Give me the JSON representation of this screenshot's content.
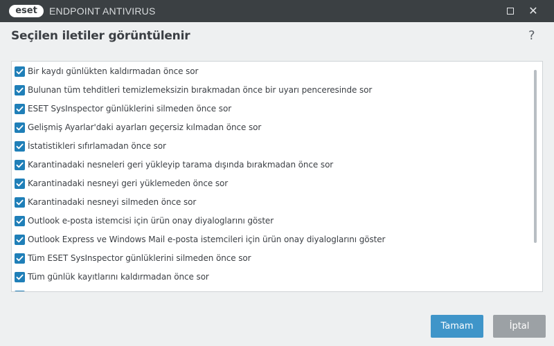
{
  "window": {
    "logo_text": "eset",
    "app_title": "ENDPOINT ANTIVIRUS",
    "maximize_icon": "maximize-icon",
    "close_glyph": "✕"
  },
  "header": {
    "title": "Seçilen iletiler görüntülenir",
    "help_glyph": "?"
  },
  "messages": [
    {
      "label": "Bir kaydı günlükten kaldırmadan önce sor",
      "checked": true
    },
    {
      "label": "Bulunan tüm tehditleri temizlemeksizin bırakmadan önce bir uyarı penceresinde sor",
      "checked": true
    },
    {
      "label": "ESET SysInspector günlüklerini silmeden önce sor",
      "checked": true
    },
    {
      "label": "Gelişmiş Ayarlar'daki ayarları geçersiz kılmadan önce sor",
      "checked": true
    },
    {
      "label": "İstatistikleri sıfırlamadan önce sor",
      "checked": true
    },
    {
      "label": "Karantinadaki nesneleri geri yükleyip tarama dışında bırakmadan önce sor",
      "checked": true
    },
    {
      "label": "Karantinadaki nesneyi geri yüklemeden önce sor",
      "checked": true
    },
    {
      "label": "Karantinadaki nesneyi silmeden önce sor",
      "checked": true
    },
    {
      "label": "Outlook e-posta istemcisi için ürün onay diyaloglarını göster",
      "checked": true
    },
    {
      "label": "Outlook Express ve Windows Mail e-posta istemcileri için ürün onay diyaloglarını göster",
      "checked": true
    },
    {
      "label": "Tüm ESET SysInspector günlüklerini silmeden önce sor",
      "checked": true
    },
    {
      "label": "Tüm günlük kayıtlarını kaldırmadan önce sor",
      "checked": true
    },
    {
      "label": "",
      "checked": true
    }
  ],
  "buttons": {
    "ok": "Tamam",
    "cancel": "İptal"
  },
  "colors": {
    "titlebar": "#3b4043",
    "checkbox": "#1f7fb8",
    "ok_button": "#3f95c9",
    "cancel_button": "#9ca1a5"
  }
}
